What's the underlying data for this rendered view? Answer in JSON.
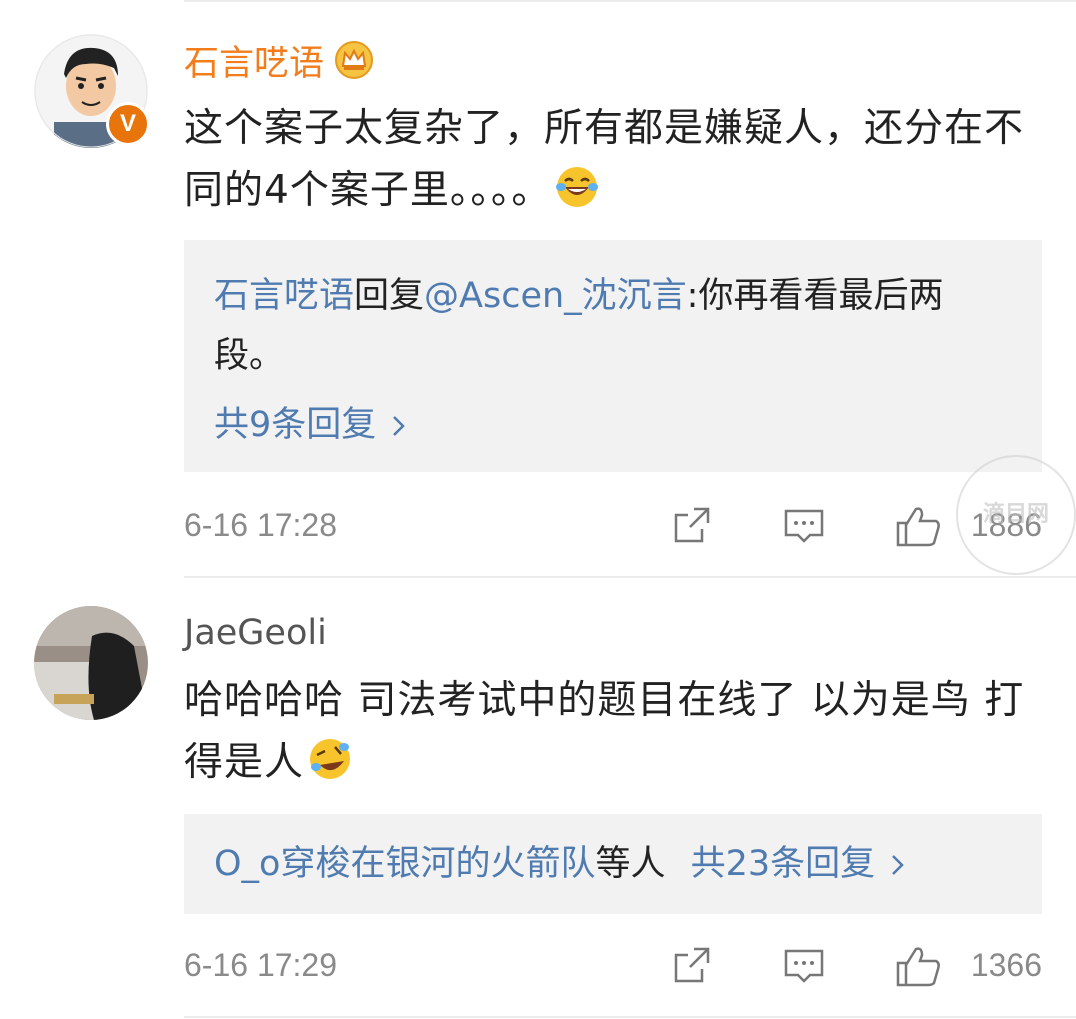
{
  "comments": [
    {
      "username": "石言呓语",
      "verified_badge": "V",
      "crown_icon": "crown-icon",
      "text": "这个案子太复杂了，所有都是嫌疑人，还分在不同的4个案子里。。。。",
      "emoji": "laughing-tears-emoji",
      "reply": {
        "author": "石言呓语",
        "verb": "回复",
        "mention": "@Ascen_沈沉言",
        "text": ":你再看看最后两段。"
      },
      "more_replies": "共9条回复",
      "timestamp": "6-16 17:28",
      "likes": "1886"
    },
    {
      "username": "JaeGeoli",
      "text": "哈哈哈哈 司法考试中的题目在线了 以为是鸟 打得是人",
      "emoji": "rolling-laughing-emoji",
      "reply_summary": {
        "users": "O_o穿梭在银河的火箭队",
        "others": "等人",
        "count": "共23条回复"
      },
      "timestamp": "6-16 17:29",
      "likes": "1366"
    }
  ],
  "watermark": "滴目网",
  "colors": {
    "username_vip": "#f37c1b",
    "link_blue": "#4f7bb0",
    "reply_bg": "#f2f2f2",
    "meta_gray": "#8a8a8a"
  }
}
